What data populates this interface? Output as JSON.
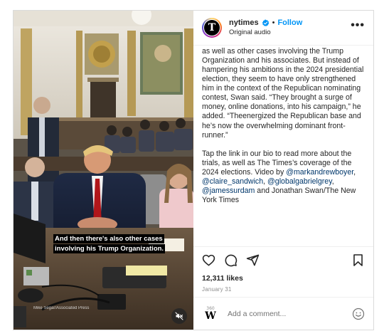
{
  "media": {
    "caption_lines": [
      "And then there's also other cases",
      "involving his Trump Organization."
    ],
    "photo_credit": "Mike Segar/Associated Press",
    "mute_icon": "speaker-muted-icon"
  },
  "header": {
    "username": "nytimes",
    "verified_icon": "verified-badge-icon",
    "separator": "•",
    "follow_label": "Follow",
    "audio_label": "Original audio",
    "more_label": "•••",
    "accent_color": "#0095f6"
  },
  "caption": {
    "para1": "as well as other cases involving the Trump Organization and his associates. But instead of hampering his ambitions in the 2024 presidential election, they seem to have only strengthened him in the context of the Republican nominating contest, Swan said. “They brought a surge of money, online donations, into his campaign,” he added. “The",
    "para1b": "energized the Republican base and he’s now the overwhelming dominant front-runner.”",
    "para2_text": "Tap the link in our bio to read more about the trials, as well as The Times’s coverage of the 2024 elections. Video by",
    "mentions": [
      "@markandrewboyer",
      "@claire_sandwich",
      "@globalgabrielgrey",
      "@jamessurdam"
    ],
    "sep1": ",",
    "sep2": ",",
    "sep3": ",",
    "tail": "and Jonathan Swan/The New York Times",
    "mention_color": "#00376b"
  },
  "actions": {
    "icons": [
      "heart-icon",
      "comment-icon",
      "share-icon",
      "bookmark-icon"
    ],
    "likes": "12,311 likes",
    "date": "January 31"
  },
  "comment": {
    "avatar_top": "360",
    "avatar_letter": "W",
    "placeholder": "Add a comment...",
    "emoji_icon": "smiley-icon"
  }
}
